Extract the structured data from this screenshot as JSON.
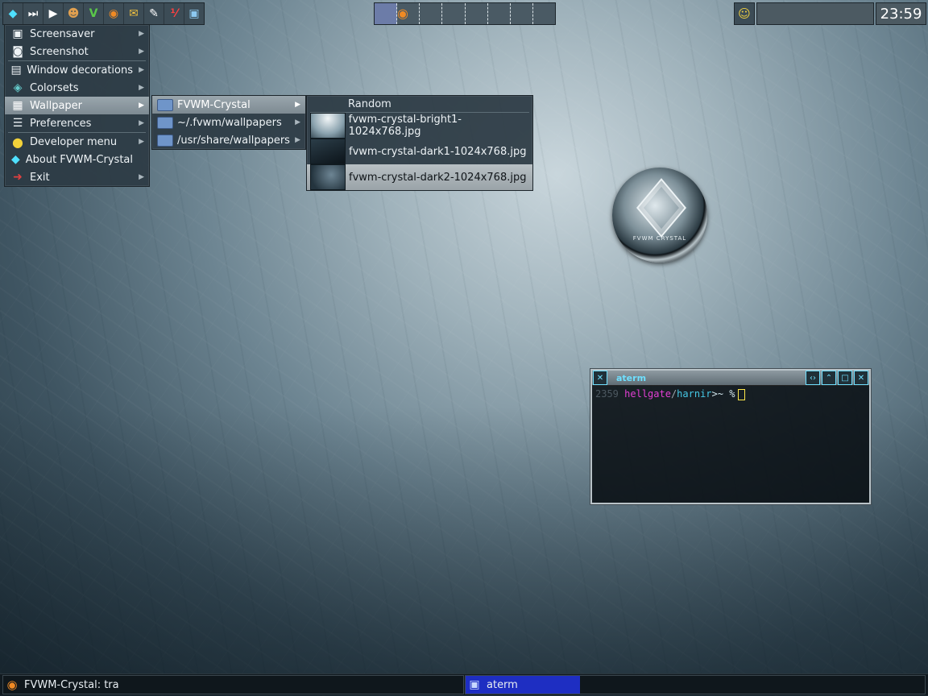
{
  "top_panel": {
    "launcher_icons": [
      "crystal-icon",
      "skip-forward-icon",
      "play-icon",
      "game-icon",
      "vim-icon",
      "firefox-icon",
      "mail-icon",
      "text-editor-icon",
      "calendar-icon",
      "monitor-icon"
    ],
    "launcher_glyphs": [
      "◆",
      "⏭",
      "▶",
      "☻",
      "V",
      "◉",
      "✉",
      "✎",
      "⅟",
      "▣"
    ],
    "clock": "23:59"
  },
  "main_menu": {
    "items": [
      {
        "label": "Screensaver",
        "icon": "screensaver-icon",
        "glyph": "▣",
        "submenu": true
      },
      {
        "label": "Screenshot",
        "icon": "camera-icon",
        "glyph": "◙",
        "submenu": true
      },
      {
        "label": "Window decorations",
        "icon": "window-decorations-icon",
        "glyph": "▤",
        "submenu": true
      },
      {
        "label": "Colorsets",
        "icon": "colorsets-icon",
        "glyph": "◈",
        "submenu": true
      },
      {
        "label": "Wallpaper",
        "icon": "wallpaper-icon",
        "glyph": "▦",
        "submenu": true,
        "selected": true
      },
      {
        "label": "Preferences",
        "icon": "preferences-icon",
        "glyph": "☰",
        "submenu": true
      },
      {
        "label": "Developer menu",
        "icon": "developer-icon",
        "glyph": "●",
        "submenu": true
      },
      {
        "label": "About FVWM-Crystal",
        "icon": "crystal-icon",
        "glyph": "◆",
        "submenu": false
      },
      {
        "label": "Exit",
        "icon": "exit-icon",
        "glyph": "➜",
        "submenu": true
      }
    ]
  },
  "wallpaper_menu": {
    "items": [
      {
        "label": "FVWM-Crystal",
        "selected": true
      },
      {
        "label": "~/.fvwm/wallpapers",
        "selected": false
      },
      {
        "label": "/usr/share/wallpapers",
        "selected": false
      }
    ]
  },
  "image_menu": {
    "title": "Random",
    "items": [
      {
        "label": "fvwm-crystal-bright1-1024x768.jpg",
        "selected": false
      },
      {
        "label": "fvwm-crystal-dark1-1024x768.jpg",
        "selected": false
      },
      {
        "label": "fvwm-crystal-dark2-1024x768.jpg",
        "selected": true
      }
    ]
  },
  "logo": {
    "text": "FVWM CRYSTAL"
  },
  "aterm": {
    "title": "aterm",
    "prompt_number": "2359",
    "host": "hellgate",
    "slash": "/",
    "dir": "harnir",
    "tilde": ">~",
    "symbol": "%"
  },
  "taskbar": {
    "tasks": [
      {
        "label": "FVWM-Crystal: tra",
        "icon": "firefox-icon",
        "active": false
      },
      {
        "label": "aterm",
        "icon": "terminal-icon",
        "active": true
      }
    ]
  },
  "colors": {
    "accent_blue": "#1e2ec2",
    "terminal_host": "#e23fd4",
    "terminal_dir": "#45c8e6"
  }
}
